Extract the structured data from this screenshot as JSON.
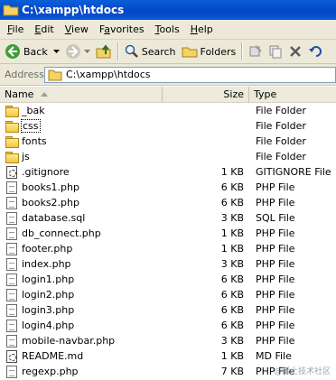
{
  "window": {
    "title": "C:\\xampp\\htdocs"
  },
  "menu": [
    {
      "pre": "",
      "key": "F",
      "post": "ile"
    },
    {
      "pre": "",
      "key": "E",
      "post": "dit"
    },
    {
      "pre": "",
      "key": "V",
      "post": "iew"
    },
    {
      "pre": "F",
      "key": "a",
      "post": "vorites"
    },
    {
      "pre": "",
      "key": "T",
      "post": "ools"
    },
    {
      "pre": "",
      "key": "H",
      "post": "elp"
    }
  ],
  "toolbar": {
    "back": "Back",
    "search": "Search",
    "folders": "Folders"
  },
  "address": {
    "label": "Address",
    "path": "C:\\xampp\\htdocs"
  },
  "columns": {
    "name": "Name",
    "size": "Size",
    "type": "Type"
  },
  "files": [
    {
      "name": "_bak",
      "size": "",
      "type": "File Folder",
      "icon": "folder-icon"
    },
    {
      "name": "css",
      "size": "",
      "type": "File Folder",
      "icon": "folder-icon",
      "focused": true
    },
    {
      "name": "fonts",
      "size": "",
      "type": "File Folder",
      "icon": "folder-icon"
    },
    {
      "name": "js",
      "size": "",
      "type": "File Folder",
      "icon": "folder-icon"
    },
    {
      "name": ".gitignore",
      "size": "1 KB",
      "type": "GITIGNORE File",
      "icon": "system-file-icon"
    },
    {
      "name": "books1.php",
      "size": "6 KB",
      "type": "PHP File",
      "icon": "document-icon"
    },
    {
      "name": "books2.php",
      "size": "6 KB",
      "type": "PHP File",
      "icon": "document-icon"
    },
    {
      "name": "database.sql",
      "size": "3 KB",
      "type": "SQL File",
      "icon": "document-icon"
    },
    {
      "name": "db_connect.php",
      "size": "1 KB",
      "type": "PHP File",
      "icon": "document-icon"
    },
    {
      "name": "footer.php",
      "size": "1 KB",
      "type": "PHP File",
      "icon": "document-icon"
    },
    {
      "name": "index.php",
      "size": "3 KB",
      "type": "PHP File",
      "icon": "document-icon"
    },
    {
      "name": "login1.php",
      "size": "6 KB",
      "type": "PHP File",
      "icon": "document-icon"
    },
    {
      "name": "login2.php",
      "size": "6 KB",
      "type": "PHP File",
      "icon": "document-icon"
    },
    {
      "name": "login3.php",
      "size": "6 KB",
      "type": "PHP File",
      "icon": "document-icon"
    },
    {
      "name": "login4.php",
      "size": "6 KB",
      "type": "PHP File",
      "icon": "document-icon"
    },
    {
      "name": "mobile-navbar.php",
      "size": "3 KB",
      "type": "PHP File",
      "icon": "document-icon"
    },
    {
      "name": "README.md",
      "size": "1 KB",
      "type": "MD File",
      "icon": "system-file-icon"
    },
    {
      "name": "regexp.php",
      "size": "7 KB",
      "type": "PHP File",
      "icon": "document-icon"
    }
  ],
  "watermark": "@稀土技术社区"
}
